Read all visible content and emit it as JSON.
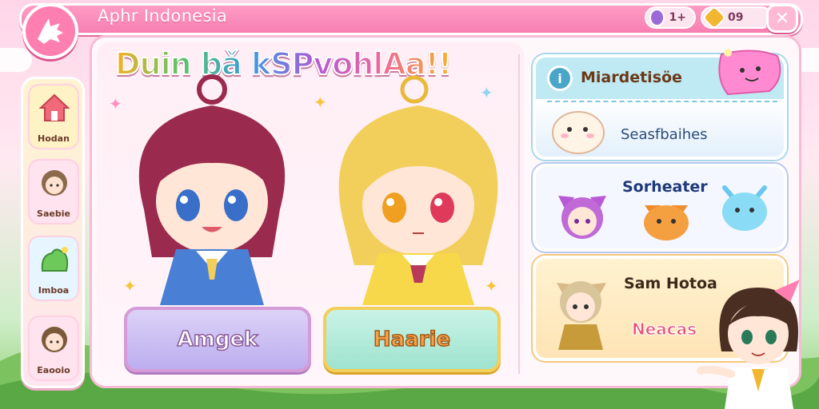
{
  "header": {
    "title": "Aphr Indonesia",
    "gems": "1+",
    "gold": "09",
    "close_symbol": "✕"
  },
  "sidebar": {
    "items": [
      {
        "label": "Hodan",
        "icon": "home-icon"
      },
      {
        "label": "Saebie",
        "icon": "avatar-icon"
      },
      {
        "label": "Imboa",
        "icon": "frog-icon"
      },
      {
        "label": "Eaooio",
        "icon": "avatar-icon"
      }
    ]
  },
  "main": {
    "headline": "Duin bǎ kSPvohlAa!!",
    "characters": [
      {
        "name": "Amgek",
        "hair": "#9a2a4e",
        "dress": "#4a7fd6"
      },
      {
        "name": "Haarie",
        "hair": "#f2cf5a",
        "dress": "#f7d84a"
      }
    ]
  },
  "panel": {
    "card1_title": "Miardetisöe",
    "card1_sub": "Seasfbaihes",
    "card2_title": "Sorheater",
    "card3_title": "Sam Hotoa",
    "card3_sub": "Neacas"
  },
  "colors": {
    "accent": "#f77fb2",
    "panel_border": "#f7bcd5"
  }
}
